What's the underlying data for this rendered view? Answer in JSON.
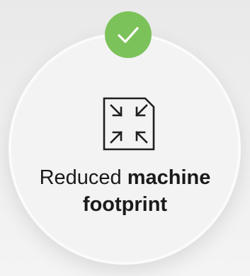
{
  "colors": {
    "accent_green": "#7cc25a",
    "text": "#1a1a1a",
    "circle_bg": "#f3f3f3",
    "border": "#fbfbfb"
  },
  "icons": {
    "status": "checkmark-icon",
    "feature": "shrink-arrows-icon"
  },
  "feature": {
    "title_regular": "Reduced",
    "title_bold_line1": "machine",
    "title_bold_line2": "footprint"
  }
}
